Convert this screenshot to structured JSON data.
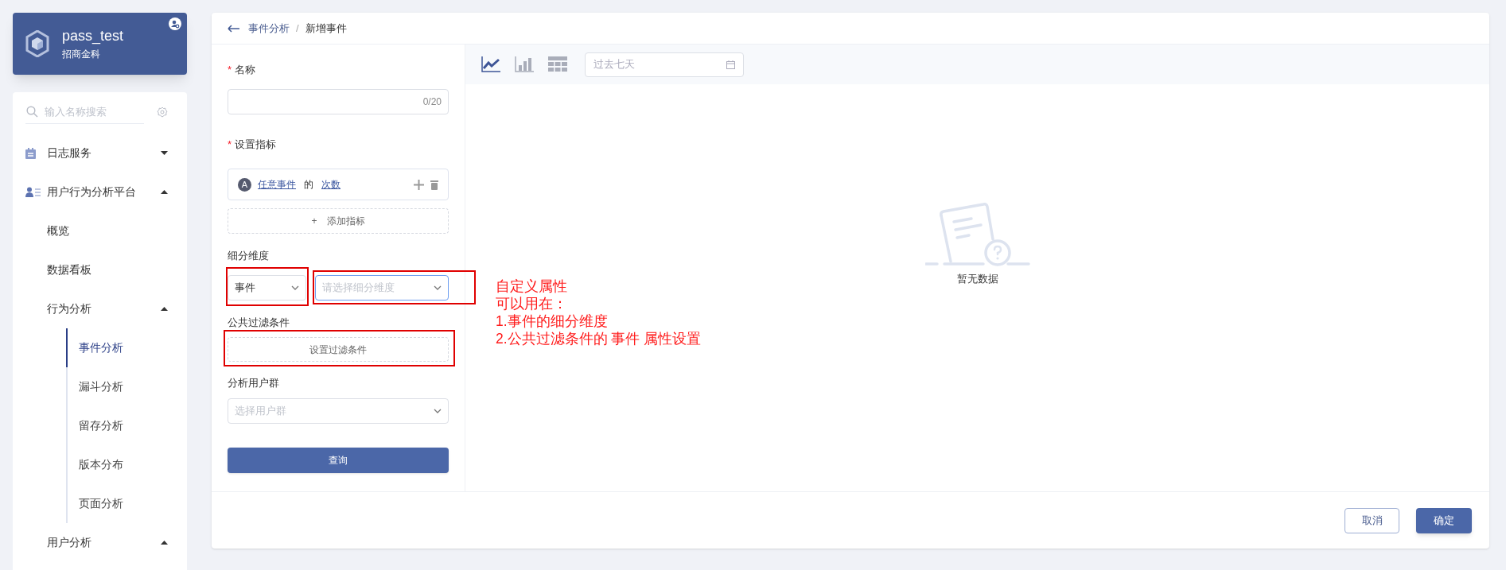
{
  "sidebar": {
    "project": {
      "title": "pass_test",
      "subtitle": "招商金科"
    },
    "search": {
      "placeholder": "输入名称搜索"
    },
    "menu": [
      {
        "label": "日志服务",
        "expanded": false,
        "selected": false
      },
      {
        "label": "用户行为分析平台",
        "expanded": true,
        "selected": false,
        "children": [
          {
            "label": "概览",
            "selected": false
          },
          {
            "label": "数据看板",
            "selected": false
          },
          {
            "label": "行为分析",
            "expanded": true,
            "selected": false,
            "children": [
              {
                "label": "事件分析",
                "selected": true
              },
              {
                "label": "漏斗分析",
                "selected": false
              },
              {
                "label": "留存分析",
                "selected": false
              },
              {
                "label": "版本分布",
                "selected": false
              },
              {
                "label": "页面分析",
                "selected": false
              }
            ]
          },
          {
            "label": "用户分析",
            "expanded": true,
            "selected": false
          }
        ]
      }
    ]
  },
  "breadcrumb": [
    "事件分析",
    "新增事件"
  ],
  "breadcrumb_separator": "/",
  "form": {
    "name_mark": "*",
    "name_label": "名称",
    "name_counter": "0/20",
    "metrics_mark": "*",
    "metrics_label": "设置指标",
    "metrics": [
      {
        "badge": "A",
        "event": "任意事件",
        "joiner": "的",
        "measure": "次数"
      }
    ],
    "add_metric": "添加指标",
    "add_metric_icon": "+",
    "breakdown_label": "细分维度",
    "breakdown_type": "事件",
    "breakdown_placeholder": "请选择细分维度",
    "filter_label": "公共过滤条件",
    "filter_button": "设置过滤条件",
    "group_label": "分析用户群",
    "group_placeholder": "选择用户群",
    "query_button": "查询"
  },
  "chart_toolbar": {
    "types": [
      {
        "kind": "line",
        "selected": true
      },
      {
        "kind": "bar",
        "selected": false
      },
      {
        "kind": "table",
        "selected": false
      }
    ],
    "date_placeholder": "过去七天"
  },
  "empty_text": "暂无数据",
  "note": [
    "自定义属性",
    "可以用在：",
    "1.事件的细分维度",
    "2.公共过滤条件的 事件 属性设置"
  ],
  "footer": {
    "cancel": "取消",
    "confirm": "确定"
  }
}
